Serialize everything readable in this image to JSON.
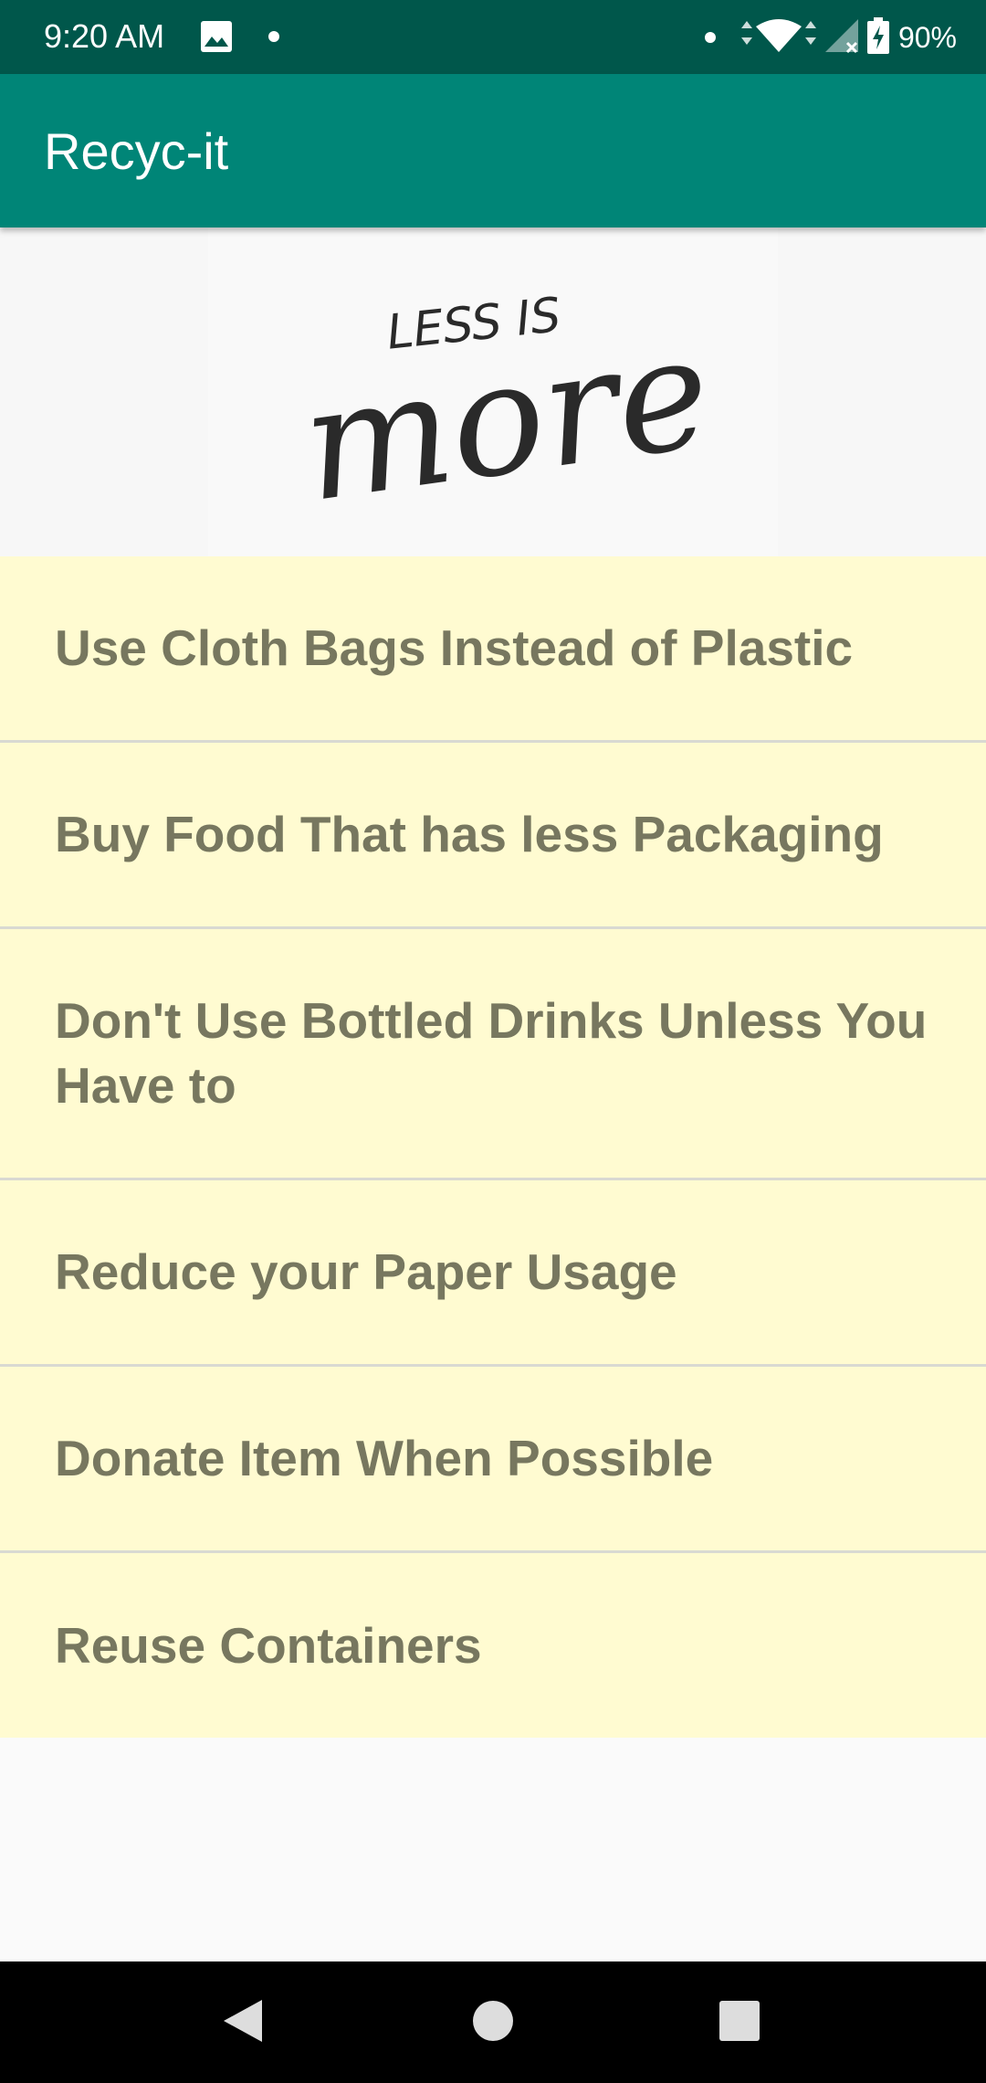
{
  "status_bar": {
    "time": "9:20 AM",
    "battery": "90%",
    "icons": [
      "gallery-icon",
      "notification-dot-icon",
      "wifi-icon",
      "signal-icon",
      "battery-icon"
    ]
  },
  "app_bar": {
    "title": "Recyc-it"
  },
  "banner": {
    "image": "less-is-more-lettering",
    "lettering": [
      "LESS IS",
      "more"
    ]
  },
  "tips": [
    "Use Cloth Bags Instead of Plastic",
    "Buy Food That has less Packaging",
    "Don't Use Bottled Drinks Unless You Have to",
    "Reduce your Paper Usage",
    "Donate Item When Possible",
    "Reuse Containers"
  ],
  "nav_bar": {
    "buttons": [
      "back-icon",
      "home-icon",
      "recents-icon"
    ]
  },
  "colors": {
    "status_bar": "#00574b",
    "app_bar": "#008577",
    "list_item_bg": "#fffbd1",
    "list_item_text": "#77775f"
  }
}
